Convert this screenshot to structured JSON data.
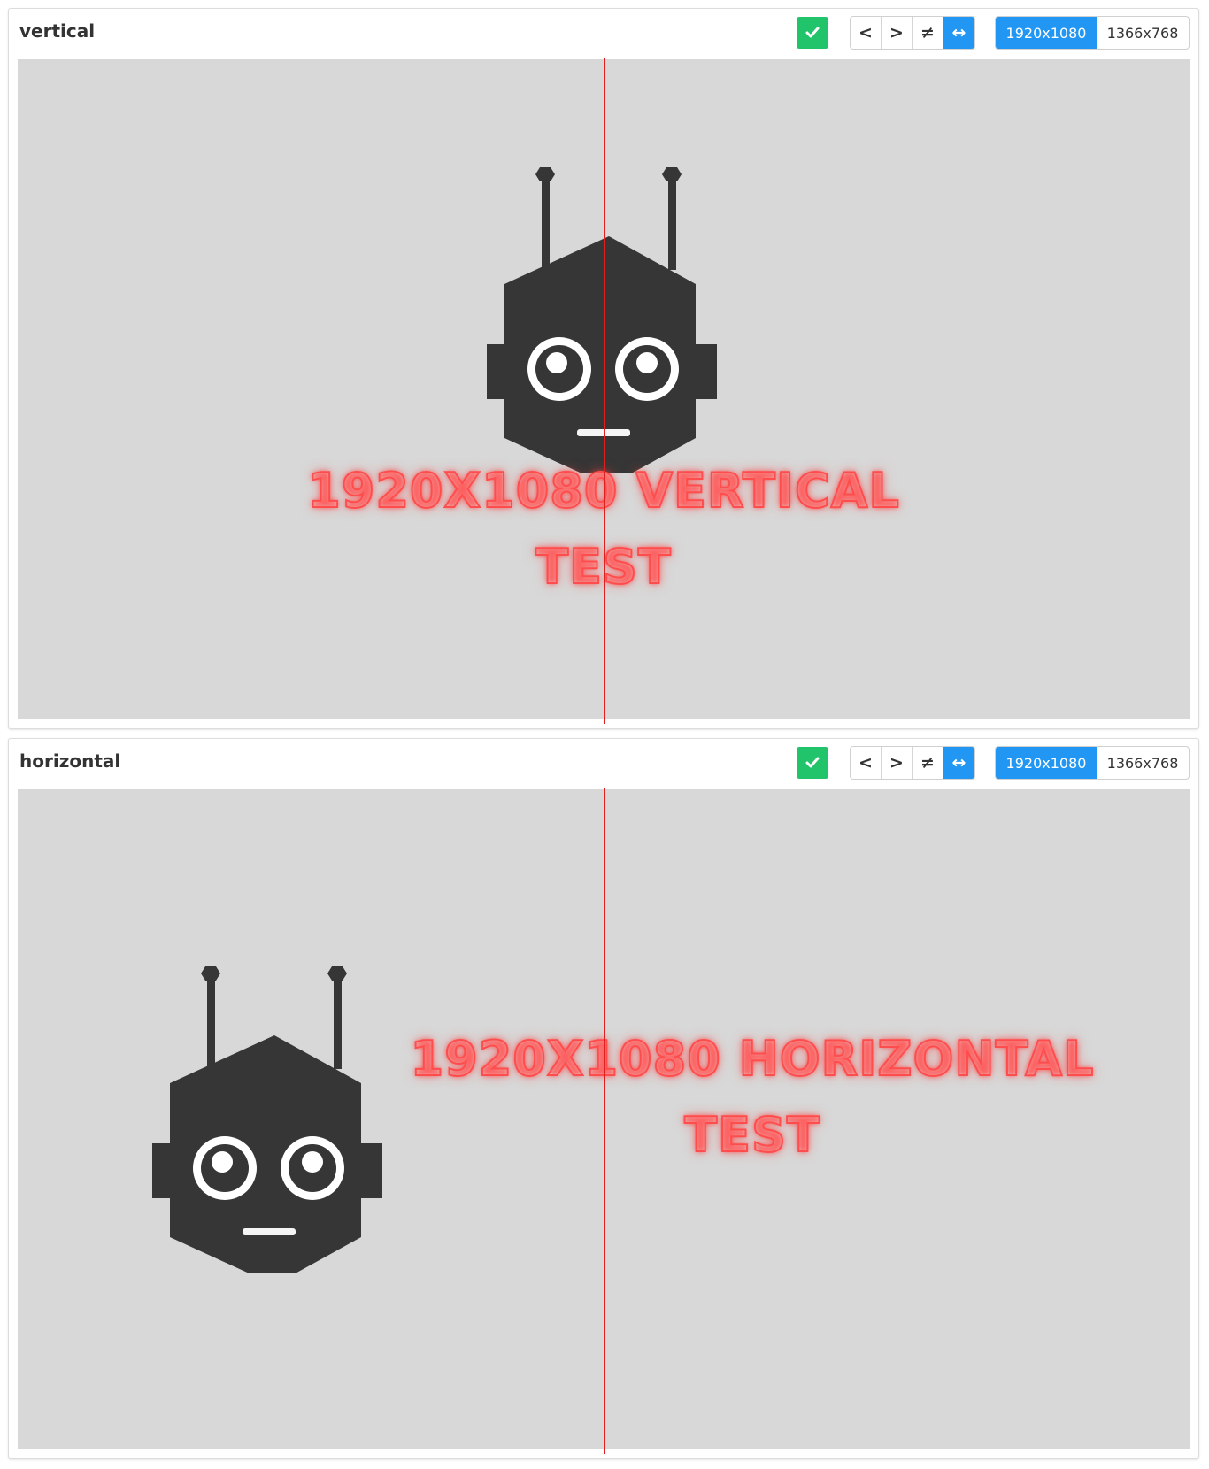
{
  "panels": [
    {
      "title": "vertical",
      "nav": [
        "<",
        ">",
        "≠",
        "↔"
      ],
      "resolutions": [
        "1920x1080",
        "1366x768"
      ],
      "active_resolution": "1920x1080",
      "neon_text_line1": "1920X1080 VERTICAL",
      "neon_text_line2": "TEST"
    },
    {
      "title": "horizontal",
      "nav": [
        "<",
        ">",
        "≠",
        "↔"
      ],
      "resolutions": [
        "1920x1080",
        "1366x768"
      ],
      "active_resolution": "1920x1080",
      "neon_text_line1": "1920X1080 HORIZONTAL",
      "neon_text_line2": "TEST"
    }
  ],
  "colors": {
    "accent": "#2196f3",
    "approve": "#21c46a",
    "divider": "#e02020",
    "neon": "#ff4d4d",
    "robot": "#363636",
    "viewport_bg": "#d8d8d8"
  },
  "icons": {
    "approve": "check-icon",
    "compare_mode": "not-equal-icon",
    "swap": "swap-horizontal-icon"
  }
}
